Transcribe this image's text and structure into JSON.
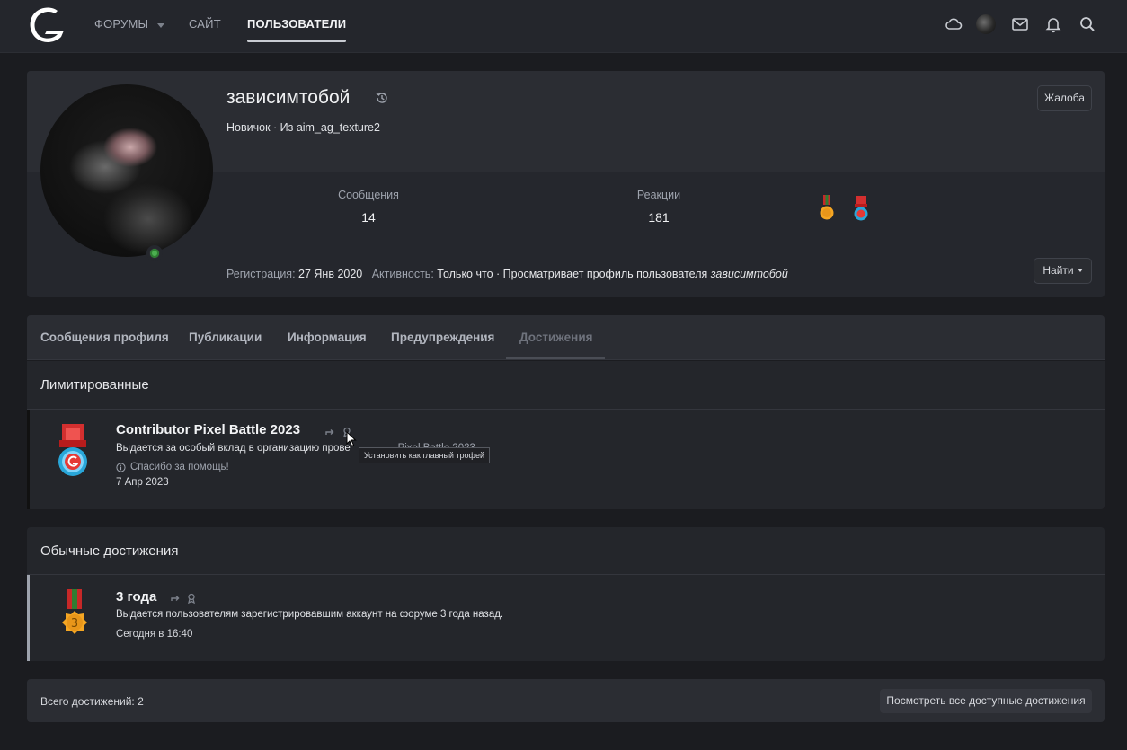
{
  "nav": {
    "forums": "ФОРУМЫ",
    "site": "САЙТ",
    "users": "ПОЛЬЗОВАТЕЛИ"
  },
  "profile": {
    "username": "зависимтобой",
    "subtitle": "Новичок · Из aim_ag_texture2",
    "report_label": "Жалоба",
    "stats": [
      {
        "label": "Сообщения",
        "value": "14"
      },
      {
        "label": "Реакции",
        "value": "181"
      }
    ],
    "registration_label": "Регистрация:",
    "registration_value": "27 Янв 2020",
    "activity_label": "Активность:",
    "activity_value": "Только что · Просматривает профиль пользователя",
    "activity_user": "зависимтобой",
    "find_label": "Найти"
  },
  "tabs": [
    {
      "label": "Сообщения профиля"
    },
    {
      "label": "Публикации"
    },
    {
      "label": "Информация"
    },
    {
      "label": "Предупреждения"
    },
    {
      "label": "Достижения",
      "active": true
    }
  ],
  "limited": {
    "title": "Лимитированные",
    "items": [
      {
        "name": "Contributor Pixel Battle 2023",
        "description": "Выдается за особый вклад в организацию прове",
        "description_tail": "...Pixel Battle 2023",
        "note": "Спасибо за помощь!",
        "date": "7 Апр 2023",
        "tooltip": "Установить как главный трофей"
      }
    ]
  },
  "regular": {
    "title": "Обычные достижения",
    "items": [
      {
        "name": "3 года",
        "description": "Выдается пользователям зарегистрировавшим аккаунт на форуме 3 года назад.",
        "date": "Сегодня в 16:40"
      }
    ]
  },
  "footer": {
    "total": "Всего достижений: 2",
    "view_all": "Посмотреть все доступные достижения"
  },
  "colors": {
    "background": "#1b1c20",
    "panel": "#25272d",
    "online": "#4caf50"
  }
}
